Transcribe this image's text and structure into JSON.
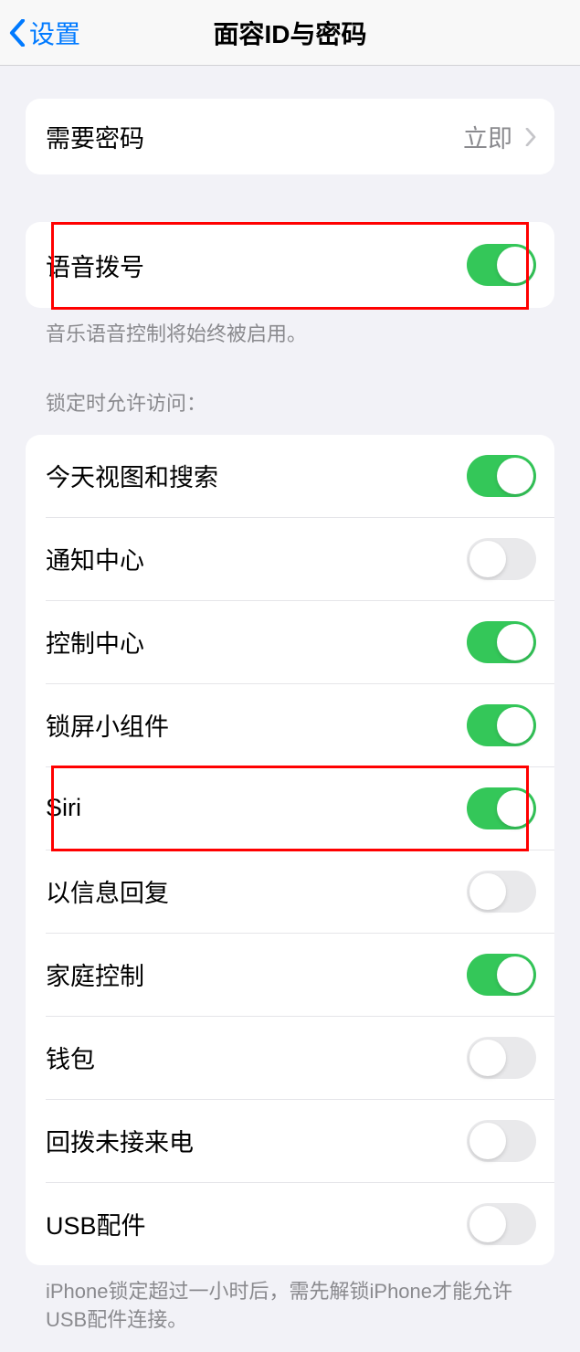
{
  "header": {
    "back_label": "设置",
    "title": "面容ID与密码"
  },
  "passcode_row": {
    "label": "需要密码",
    "value": "立即"
  },
  "voice_dial": {
    "label": "语音拨号",
    "footer": "音乐语音控制将始终被启用。"
  },
  "lock_section": {
    "header": "锁定时允许访问：",
    "items": [
      {
        "label": "今天视图和搜索",
        "on": true
      },
      {
        "label": "通知中心",
        "on": false
      },
      {
        "label": "控制中心",
        "on": true
      },
      {
        "label": "锁屏小组件",
        "on": true
      },
      {
        "label": "Siri",
        "on": true
      },
      {
        "label": "以信息回复",
        "on": false
      },
      {
        "label": "家庭控制",
        "on": true
      },
      {
        "label": "钱包",
        "on": false
      },
      {
        "label": "回拨未接来电",
        "on": false
      },
      {
        "label": "USB配件",
        "on": false
      }
    ],
    "footer": "iPhone锁定超过一小时后，需先解锁iPhone才能允许USB配件连接。"
  }
}
